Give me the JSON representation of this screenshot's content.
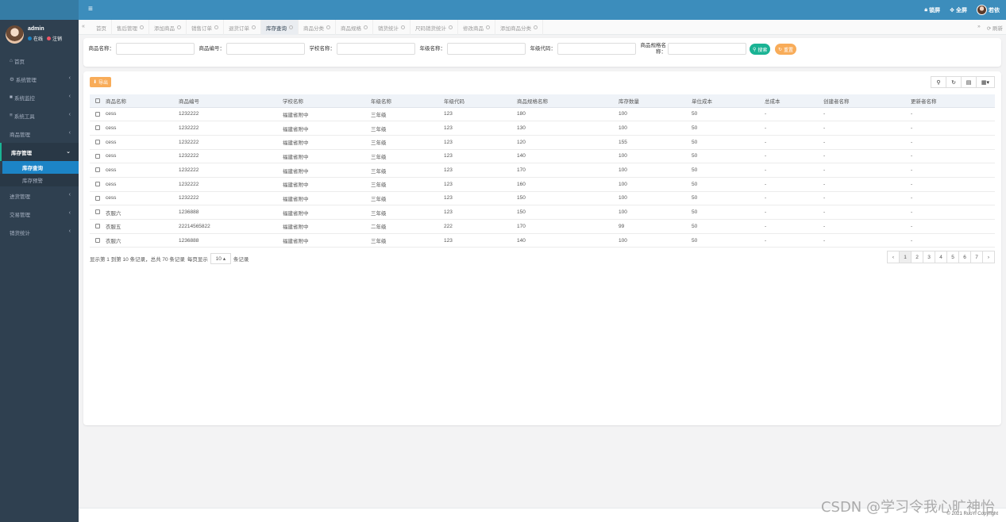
{
  "topbar": {
    "menu_icon": "hamburger-icon",
    "lock_label": "锁屏",
    "fullscreen_label": "全屏",
    "user_label": "若依"
  },
  "sidebar": {
    "user": {
      "name": "admin",
      "online_label": "在线",
      "logout_label": "注销"
    },
    "items": [
      {
        "label": "首页",
        "icon": "home-icon",
        "has_arrow": false
      },
      {
        "label": "系统管理",
        "icon": "gear-icon",
        "has_arrow": true
      },
      {
        "label": "系统监控",
        "icon": "video-icon",
        "has_arrow": true
      },
      {
        "label": "系统工具",
        "icon": "list-icon",
        "has_arrow": true
      },
      {
        "label": "商品管理",
        "icon": "",
        "has_arrow": true
      },
      {
        "label": "库存管理",
        "icon": "",
        "has_arrow": true,
        "active": true
      },
      {
        "label": "进货管理",
        "icon": "",
        "has_arrow": true
      },
      {
        "label": "交易管理",
        "icon": "",
        "has_arrow": true
      },
      {
        "label": "销货统计",
        "icon": "",
        "has_arrow": true
      }
    ],
    "subitems": [
      {
        "label": "库存查询",
        "selected": true
      },
      {
        "label": "库存预警",
        "selected": false
      }
    ]
  },
  "tabs": {
    "items": [
      "首页",
      "售后管理",
      "添加商品",
      "销售订单",
      "退货订单",
      "库存查询",
      "商品分类",
      "商品规格",
      "销货统计",
      "尺码销货统计",
      "修改商品",
      "添加商品分类"
    ],
    "active_index": 5,
    "refresh_label": "刷新"
  },
  "search": {
    "fields": [
      {
        "label": "商品名称：",
        "value": ""
      },
      {
        "label": "商品编号：",
        "value": ""
      },
      {
        "label": "学校名称：",
        "value": ""
      },
      {
        "label": "年级名称：",
        "value": ""
      },
      {
        "label": "年级代码：",
        "value": ""
      },
      {
        "label": "商品规格名称：",
        "value": ""
      }
    ],
    "search_label": "搜索",
    "reset_label": "重置"
  },
  "table": {
    "export_label": "导出",
    "columns": [
      "商品名称",
      "商品编号",
      "学校名称",
      "年级名称",
      "年级代码",
      "商品规格名称",
      "库存数量",
      "单位成本",
      "总成本",
      "创建者名称",
      "更新者名称"
    ],
    "rows": [
      [
        "cess",
        "1232222",
        "福建省附中",
        "三年级",
        "123",
        "180",
        "100",
        "50",
        "-",
        "-",
        "-"
      ],
      [
        "cess",
        "1232222",
        "福建省附中",
        "三年级",
        "123",
        "130",
        "100",
        "50",
        "-",
        "-",
        "-"
      ],
      [
        "cess",
        "1232222",
        "福建省附中",
        "三年级",
        "123",
        "120",
        "155",
        "50",
        "-",
        "-",
        "-"
      ],
      [
        "cess",
        "1232222",
        "福建省附中",
        "三年级",
        "123",
        "140",
        "100",
        "50",
        "-",
        "-",
        "-"
      ],
      [
        "cess",
        "1232222",
        "福建省附中",
        "三年级",
        "123",
        "170",
        "100",
        "50",
        "-",
        "-",
        "-"
      ],
      [
        "cess",
        "1232222",
        "福建省附中",
        "三年级",
        "123",
        "160",
        "100",
        "50",
        "-",
        "-",
        "-"
      ],
      [
        "cess",
        "1232222",
        "福建省附中",
        "三年级",
        "123",
        "150",
        "100",
        "50",
        "-",
        "-",
        "-"
      ],
      [
        "衣服六",
        "1236888",
        "福建省附中",
        "三年级",
        "123",
        "150",
        "100",
        "50",
        "-",
        "-",
        "-"
      ],
      [
        "衣服五",
        "22214565822",
        "福建省附中",
        "二年级",
        "222",
        "170",
        "99",
        "50",
        "-",
        "-",
        "-"
      ],
      [
        "衣服六",
        "1236888",
        "福建省附中",
        "三年级",
        "123",
        "140",
        "100",
        "50",
        "-",
        "-",
        "-"
      ]
    ]
  },
  "pager": {
    "info": "显示第 1 到第 10 条记录，总共 70 条记录",
    "per_page_prefix": "每页显示",
    "page_size": "10",
    "per_page_suffix": "条记录",
    "pages": [
      "‹",
      "1",
      "2",
      "3",
      "4",
      "5",
      "6",
      "7",
      "›"
    ],
    "active_page": "1"
  },
  "footer": {
    "copyright": "© 2021 RuoYi Copyright"
  },
  "watermark": "CSDN @学习令我心旷神怡"
}
